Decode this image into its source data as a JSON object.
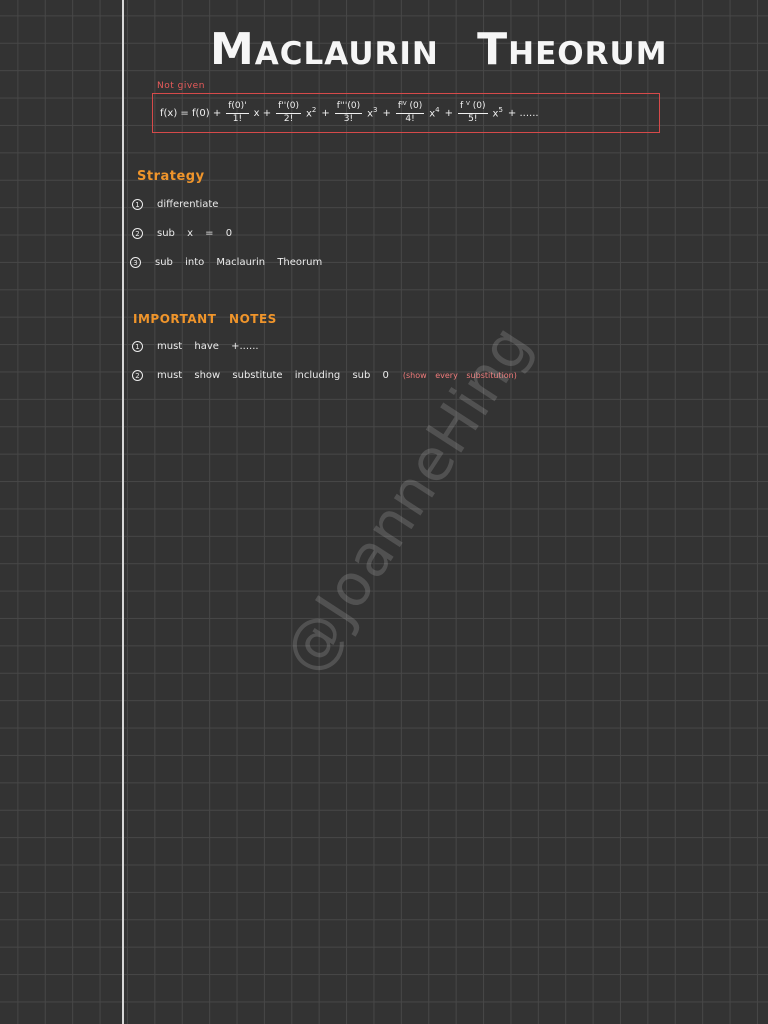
{
  "title": "Maclaurin Theorum",
  "formula_note": "Not given",
  "formula": {
    "lhs": "f(x) = f(0) +",
    "t1": {
      "num": "f(0)'",
      "den": "1!",
      "after": "x +"
    },
    "t2": {
      "num": "f''(0)",
      "den": "2!",
      "after": "x",
      "sup": "2",
      "tail": "+"
    },
    "t3": {
      "num": "f'''(0)",
      "den": "3!",
      "after": "x",
      "sup": "3",
      "tail": "+"
    },
    "t4": {
      "num": "fᴵⱽ (0)",
      "den": "4!",
      "after": "x",
      "sup": "4",
      "tail": "+"
    },
    "t5": {
      "num": "f ⱽ (0)",
      "den": "5!",
      "after": "x",
      "sup": "5",
      "tail": "+ ......"
    }
  },
  "strategy": {
    "heading": "Strategy",
    "items": [
      {
        "n": "1",
        "text": "differentiate"
      },
      {
        "n": "2",
        "text": "sub x = 0"
      },
      {
        "n": "3",
        "text": "sub into Maclaurin Theorum"
      }
    ]
  },
  "notes": {
    "heading": "IMPORTANT NOTES",
    "items": [
      {
        "n": "1",
        "text": "must have +......"
      },
      {
        "n": "2",
        "text": "must show substitute including sub 0",
        "hint": "(show every substitution)"
      }
    ]
  },
  "watermark": "@JoanneHing",
  "colors": {
    "accent": "#f0952b",
    "formula_border": "#d64a4a",
    "hint": "#f07b7b",
    "background": "#333333"
  }
}
